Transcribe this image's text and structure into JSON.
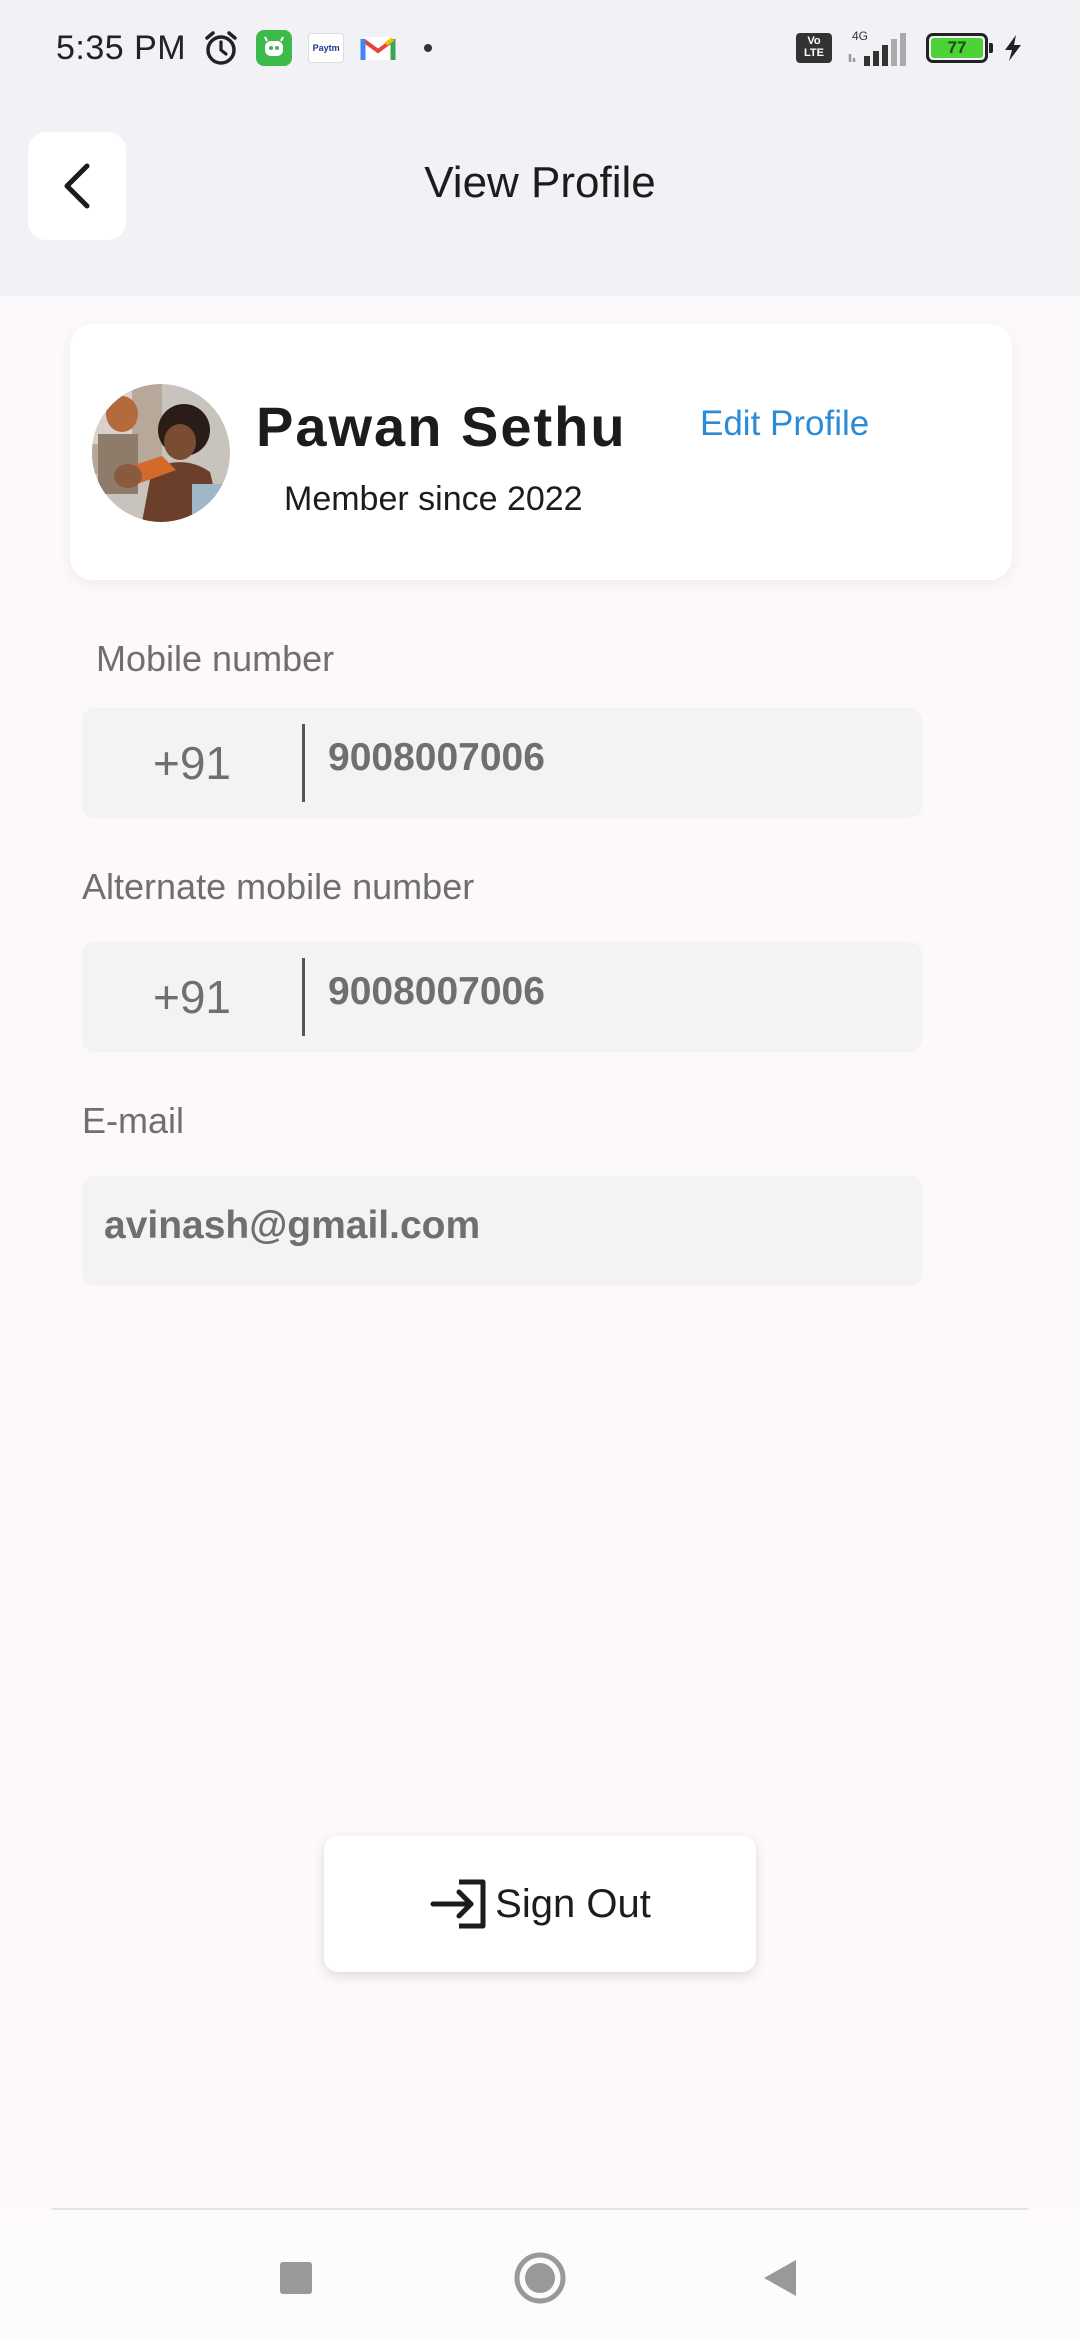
{
  "status_bar": {
    "time": "5:35 PM",
    "notification_icons": [
      "alarm-icon",
      "green-app-icon",
      "paytm-icon",
      "gmail-icon",
      "dot-icon"
    ],
    "paytm_text": "Paytm",
    "volte": "Vo LTE",
    "network": "4G",
    "battery_level": "77"
  },
  "header": {
    "title": "View Profile",
    "back_icon": "chevron-left-icon"
  },
  "profile": {
    "name": "Pawan Sethu",
    "member_since": "Member since 2022",
    "edit_label": "Edit Profile"
  },
  "fields": {
    "mobile": {
      "label": "Mobile number",
      "country_code": "+91",
      "value": "9008007006"
    },
    "alternate_mobile": {
      "label": "Alternate mobile number",
      "country_code": "+91",
      "value": "9008007006"
    },
    "email": {
      "label": "E-mail",
      "value": "avinash@gmail.com"
    }
  },
  "signout": {
    "label": "Sign Out",
    "icon": "sign-in-arrow-icon"
  },
  "nav_bar": {
    "buttons": [
      "recents-square-icon",
      "home-circle-icon",
      "back-triangle-icon"
    ]
  },
  "colors": {
    "accent": "#2a8bd8",
    "top_background": "#f2f1f6",
    "page_background": "#fdf8fb",
    "field_background": "#f3f3f3",
    "battery_green": "#4cd137"
  }
}
